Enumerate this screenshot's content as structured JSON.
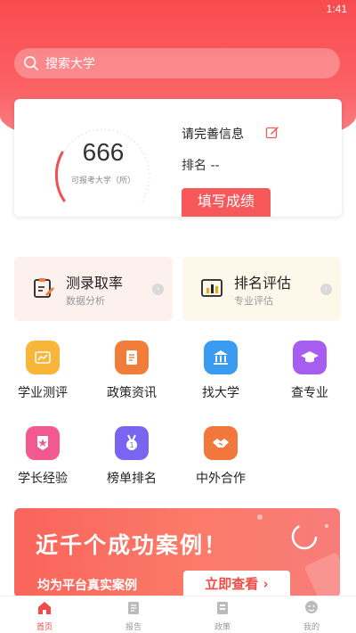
{
  "status_bar": {
    "time": "1:41"
  },
  "search": {
    "placeholder": "搜索大学"
  },
  "score_card": {
    "gauge_value": "666",
    "gauge_caption": "可报考大学（所）",
    "info_title": "请完善信息",
    "rank_text": "排名 --",
    "fill_button": "填写成绩"
  },
  "features": [
    {
      "title": "测录取率",
      "subtitle": "数据分析",
      "icon": "clipboard-edit-icon"
    },
    {
      "title": "排名评估",
      "subtitle": "专业评估",
      "icon": "bar-chart-icon"
    }
  ],
  "grid": [
    {
      "label": "学业测评",
      "icon": "trend-chart-icon",
      "color": "#f8b537"
    },
    {
      "label": "政策资讯",
      "icon": "document-icon",
      "color": "#f07d3a"
    },
    {
      "label": "找大学",
      "icon": "university-icon",
      "color": "#3a9cf0"
    },
    {
      "label": "查专业",
      "icon": "graduation-cap-icon",
      "color": "#a55ef0"
    },
    {
      "label": "学长经验",
      "icon": "badge-star-icon",
      "color": "#f25a8f"
    },
    {
      "label": "榜单排名",
      "icon": "medal-icon",
      "color": "#7966f0"
    },
    {
      "label": "中外合作",
      "icon": "handshake-icon",
      "color": "#f2773c"
    }
  ],
  "banner": {
    "headline": "近千个成功案例！",
    "subline": "均为平台真实案例",
    "button": "立即查看 ›"
  },
  "tabbar": [
    {
      "label": "首页",
      "icon": "home-icon",
      "active": true
    },
    {
      "label": "报告",
      "icon": "report-icon",
      "active": false
    },
    {
      "label": "政策",
      "icon": "policy-icon",
      "active": false
    },
    {
      "label": "我的",
      "icon": "profile-icon",
      "active": false
    }
  ],
  "colors": {
    "brand_red": "#f94b4f",
    "accent": "#f24a47"
  }
}
